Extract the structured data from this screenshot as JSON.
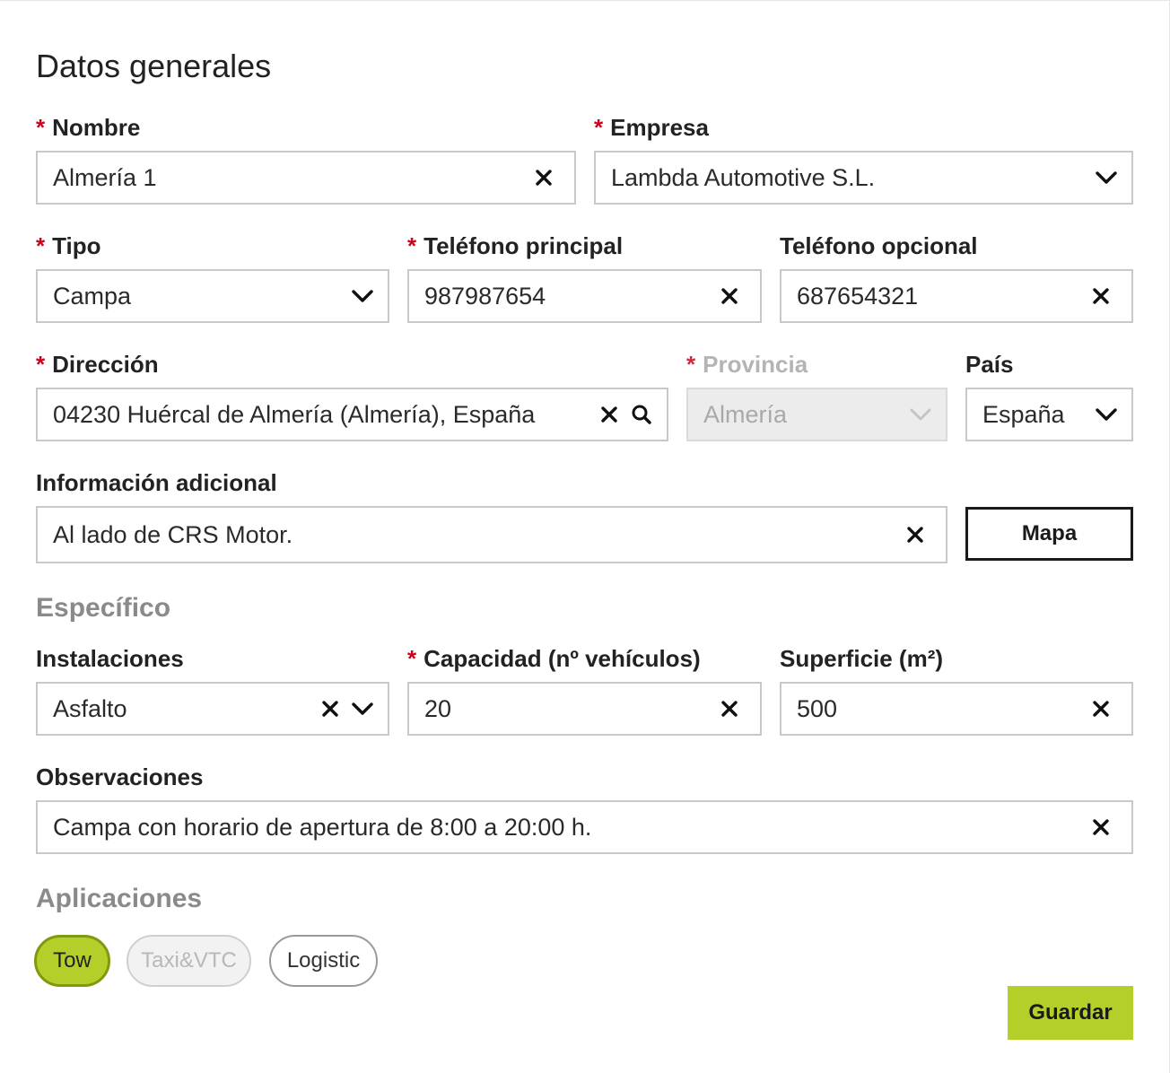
{
  "sections": {
    "general": "Datos generales",
    "specific": "Específico",
    "applications": "Aplicaciones"
  },
  "required_mark": "*",
  "fields": {
    "nombre": {
      "label": "Nombre",
      "value": "Almería 1"
    },
    "empresa": {
      "label": "Empresa",
      "value": "Lambda Automotive S.L."
    },
    "tipo": {
      "label": "Tipo",
      "value": "Campa"
    },
    "telefono_principal": {
      "label": "Teléfono principal",
      "value": "987987654"
    },
    "telefono_opcional": {
      "label": "Teléfono opcional",
      "value": "687654321"
    },
    "direccion": {
      "label": "Dirección",
      "value": "04230 Huércal de Almería (Almería), España"
    },
    "provincia": {
      "label": "Provincia",
      "value": "Almería"
    },
    "pais": {
      "label": "País",
      "value": "España"
    },
    "informacion_adicional": {
      "label": "Información adicional",
      "value": "Al lado de CRS Motor."
    },
    "instalaciones": {
      "label": "Instalaciones",
      "value": "Asfalto"
    },
    "capacidad": {
      "label": "Capacidad (nº vehículos)",
      "value": "20"
    },
    "superficie": {
      "label": "Superficie (m²)",
      "value": "500"
    },
    "observaciones": {
      "label": "Observaciones",
      "value": "Campa con horario de apertura de 8:00 a 20:00 h."
    }
  },
  "buttons": {
    "mapa": "Mapa",
    "guardar": "Guardar"
  },
  "applications": [
    {
      "label": "Tow",
      "state": "active"
    },
    {
      "label": "Taxi&VTC",
      "state": "disabled"
    },
    {
      "label": "Logistic",
      "state": "normal"
    }
  ],
  "colors": {
    "accent": "#b5cf2a",
    "required": "#d0021b",
    "muted_heading": "#8a8a8a"
  },
  "icons": {
    "clear": "close-icon",
    "dropdown": "chevron-down-icon",
    "search": "search-icon"
  }
}
